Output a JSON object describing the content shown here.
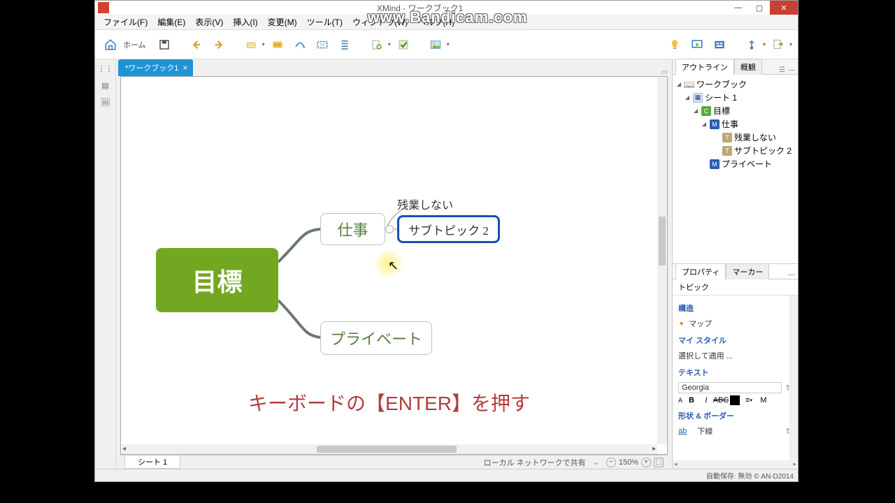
{
  "titlebar": {
    "text": "XMind - ワークブック1"
  },
  "watermark": "www.Bandicam.com",
  "menu": [
    "ファイル(F)",
    "編集(E)",
    "表示(V)",
    "挿入(I)",
    "変更(M)",
    "ツール(T)",
    "ウィンドウ(W)",
    "ヘルプ(H)"
  ],
  "toolbar": {
    "home": "ホーム"
  },
  "tab": {
    "label": "*ワークブック1"
  },
  "mindmap": {
    "central": "目標",
    "sub1": "仕事",
    "sub2": "プライベート",
    "floating": "残業しない",
    "selected": "サブトピック 2"
  },
  "caption": "キーボードの【ENTER】を押す",
  "sheet_tab": "シート 1",
  "status": {
    "share": "ローカル ネットワークで共有",
    "zoom": "150%"
  },
  "right": {
    "tabs": {
      "outline": "アウトライン",
      "overview": "概観"
    },
    "outline": {
      "book": "ワークブック",
      "sheet": "シート 1",
      "c": "目標",
      "m1": "仕事",
      "t1": "残業しない",
      "t2": "サブトピック 2",
      "m2": "プライベート"
    },
    "prop_tabs": {
      "prop": "プロパティ",
      "marker": "マーカー"
    },
    "topic_label": "トピック",
    "structure": "構造",
    "map": "マップ",
    "mystyle": "マイ スタイル",
    "apply": "選択して適用 ...",
    "text": "テキスト",
    "font": "Georgia",
    "shape": "形状 & ボーダー",
    "underline": "下線"
  },
  "app_status": "自動保存: 無効 © AN-D2014"
}
